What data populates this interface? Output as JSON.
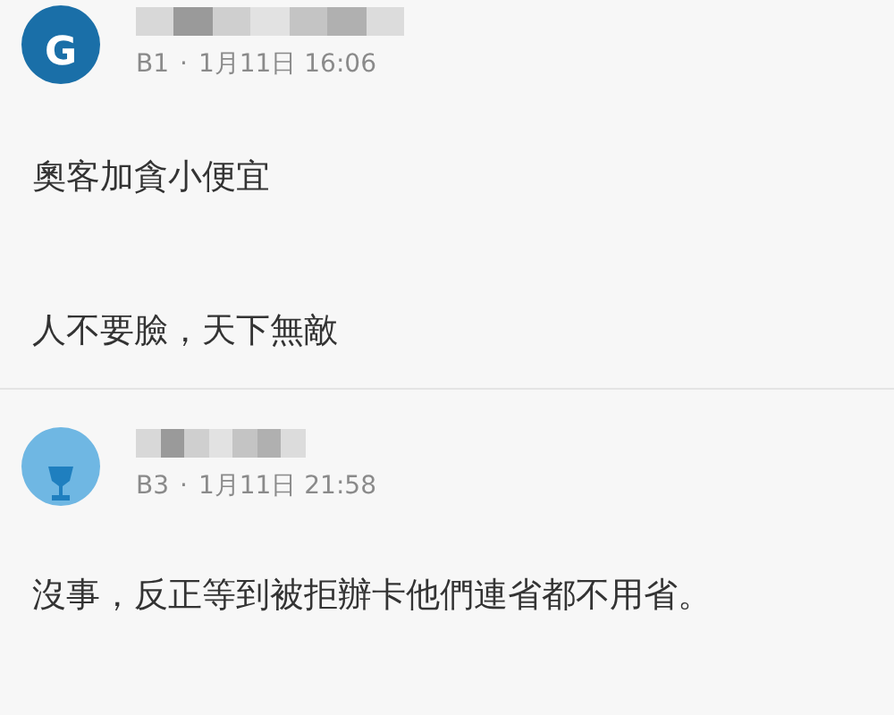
{
  "comments": [
    {
      "avatar": {
        "kind": "letter",
        "letter": "G",
        "color": "#1a6fa8"
      },
      "floor": "B1",
      "dot": "·",
      "date": "1月11日 16:06",
      "paragraphs": [
        "奧客加貪小便宜",
        "人不要臉，天下無敵"
      ]
    },
    {
      "avatar": {
        "kind": "trophy",
        "color": "#6fb7e3"
      },
      "floor": "B3",
      "dot": "·",
      "date": "1月11日 21:58",
      "paragraphs": [
        "沒事，反正等到被拒辦卡他們連省都不用省。"
      ]
    }
  ]
}
